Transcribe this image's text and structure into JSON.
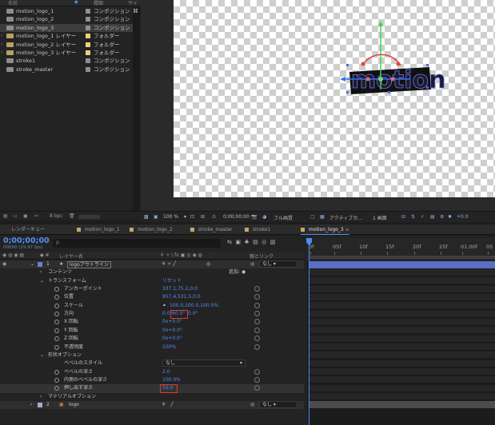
{
  "project": {
    "headers": {
      "name": "名前",
      "type": "種類",
      "size": "サイ"
    },
    "items": [
      {
        "name": "motion_logo_1",
        "type": "コンポジション",
        "kind": "comp",
        "label_color": "#8e8e8e",
        "expandable": false
      },
      {
        "name": "motion_logo_2",
        "type": "コンポジション",
        "kind": "comp",
        "label_color": "#8e8e8e",
        "expandable": false
      },
      {
        "name": "motion_logo_3",
        "type": "コンポジション",
        "kind": "comp",
        "label_color": "#8e8e8e",
        "expandable": false,
        "selected": true
      },
      {
        "name": "motion_logo_1 レイヤー",
        "type": "フォルダー",
        "kind": "folder",
        "label_color": "#e8d27a",
        "expandable": true
      },
      {
        "name": "motion_logo_2 レイヤー",
        "type": "フォルダー",
        "kind": "folder",
        "label_color": "#e8d27a",
        "expandable": true
      },
      {
        "name": "motion_logo_3 レイヤー",
        "type": "フォルダー",
        "kind": "folder",
        "label_color": "#e8d27a",
        "expandable": true
      },
      {
        "name": "stroke1",
        "type": "コンポジション",
        "kind": "comp",
        "label_color": "#8e8e8e",
        "expandable": false
      },
      {
        "name": "stroke_master",
        "type": "コンポジション",
        "kind": "comp",
        "label_color": "#8e8e8e",
        "expandable": false
      }
    ],
    "bpc": "8 bpc"
  },
  "viewer": {
    "logo_text": "motion",
    "toolbar": {
      "zoom": "100 %",
      "timecode": "0;00;00;00",
      "resolution": "フル画質",
      "camera": "アクティブカ...",
      "views": "1 画面",
      "exposure": "+0.0"
    }
  },
  "timeline": {
    "tabs": [
      {
        "label": "レンダーキュー",
        "has_icon": false
      },
      {
        "label": "motion_logo_1",
        "has_icon": true
      },
      {
        "label": "motion_logo_2",
        "has_icon": true
      },
      {
        "label": "stroke_master",
        "has_icon": true
      },
      {
        "label": "stroke1",
        "has_icon": true
      },
      {
        "label": "motion_logo_3",
        "has_icon": true,
        "active": true
      }
    ],
    "timecode": "0;00;00;00",
    "fps": "00000 (29.97 fps)",
    "search_placeholder": "ρ.",
    "columns": {
      "layer_name": "レイヤー名",
      "parent": "親とリンク"
    },
    "ruler": [
      "0f",
      "05f",
      "10f",
      "15f",
      "20f",
      "25f",
      "01:00f",
      "05"
    ],
    "layer1": {
      "index": "1",
      "name": "logoアウトライン",
      "parent": "なし"
    },
    "contents_label": "コンテンツ",
    "add_label": "追加:",
    "transform_label": "トランスフォーム",
    "reset_label": "リセット",
    "properties": [
      {
        "label": "アンカーポイント",
        "value": "337.1,75.2,0.0"
      },
      {
        "label": "位置",
        "value": "957.4,531.5,0.0"
      },
      {
        "label": "スケール",
        "value": "100.0,100.0,100.0%"
      },
      {
        "label": "方向",
        "value_a": "0.0°",
        "value_b": "60.0°",
        "value_c": "0.0°"
      },
      {
        "label": "X 回転",
        "value": "0x+0.0°"
      },
      {
        "label": "Y 回転",
        "value": "0x+0.0°"
      },
      {
        "label": "Z 回転",
        "value": "0x+0.0°"
      },
      {
        "label": "不透明度",
        "value": "100%"
      }
    ],
    "geometry_label": "形状オプション",
    "geometry": [
      {
        "label": "ベベルのスタイル",
        "value": "なし"
      },
      {
        "label": "ベベルの深さ",
        "value": "2.0"
      },
      {
        "label": "内側のベベルの深さ",
        "value": "100.0%"
      },
      {
        "label": "押し出す深さ",
        "value": "50.0"
      }
    ],
    "material_label": "マテリアルオプション",
    "layer2": {
      "index": "2",
      "name": "logo",
      "parent": "なし"
    }
  },
  "colors": {
    "accent": "#4f8ff5",
    "highlight": "#e03a2f",
    "layer_label": "#6b7fd0"
  }
}
